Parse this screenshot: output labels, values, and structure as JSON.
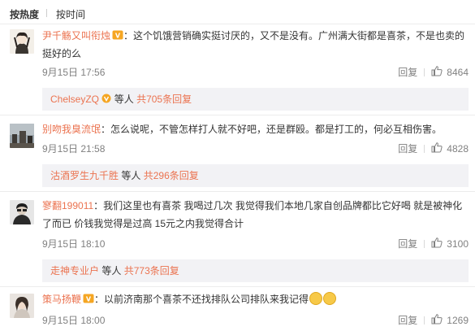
{
  "sort": {
    "hot_label": "按热度",
    "time_label": "按时间"
  },
  "comments": [
    {
      "user": "尹千觞又叫衔烛",
      "text": "：这个饥饿营销确实挺讨厌的，又不是没有。广州满大街都是喜茶，不是也卖的挺好的么",
      "time": "9月15日 17:56",
      "reply_label": "回复",
      "likes": "8464",
      "reply_summary": {
        "name": "ChelseyZQ",
        "mid": "等人",
        "more": "共705条回复"
      }
    },
    {
      "user": "别吻我臭流氓",
      "text": "：怎么说呢，不管怎样打人就不好吧，还是群殴。都是打工的，何必互相伤害。",
      "time": "9月15日 21:58",
      "reply_label": "回复",
      "likes": "4828",
      "reply_summary": {
        "name": "沽酒罗生九千胜",
        "mid": "等人",
        "more": "共296条回复"
      }
    },
    {
      "user": "寥翻199011",
      "text": "：我们这里也有喜茶 我喝过几次 我觉得我们本地几家自创品牌都比它好喝 就是被神化了而已 价钱我觉得是过高 15元之内我觉得合计",
      "time": "9月15日 18:10",
      "reply_label": "回复",
      "likes": "3100",
      "reply_summary": {
        "name": "走神专业户",
        "mid": "等人",
        "more": "共773条回复"
      }
    },
    {
      "user": "策马扬鞭",
      "text": "：以前济南那个喜茶不还找排队公司排队来我记得",
      "time": "9月15日 18:00",
      "reply_label": "回复",
      "likes": "1269"
    }
  ],
  "colors": {
    "link": "#eb7350",
    "meta": "#808080",
    "reply_bg": "#f2f2f5"
  }
}
